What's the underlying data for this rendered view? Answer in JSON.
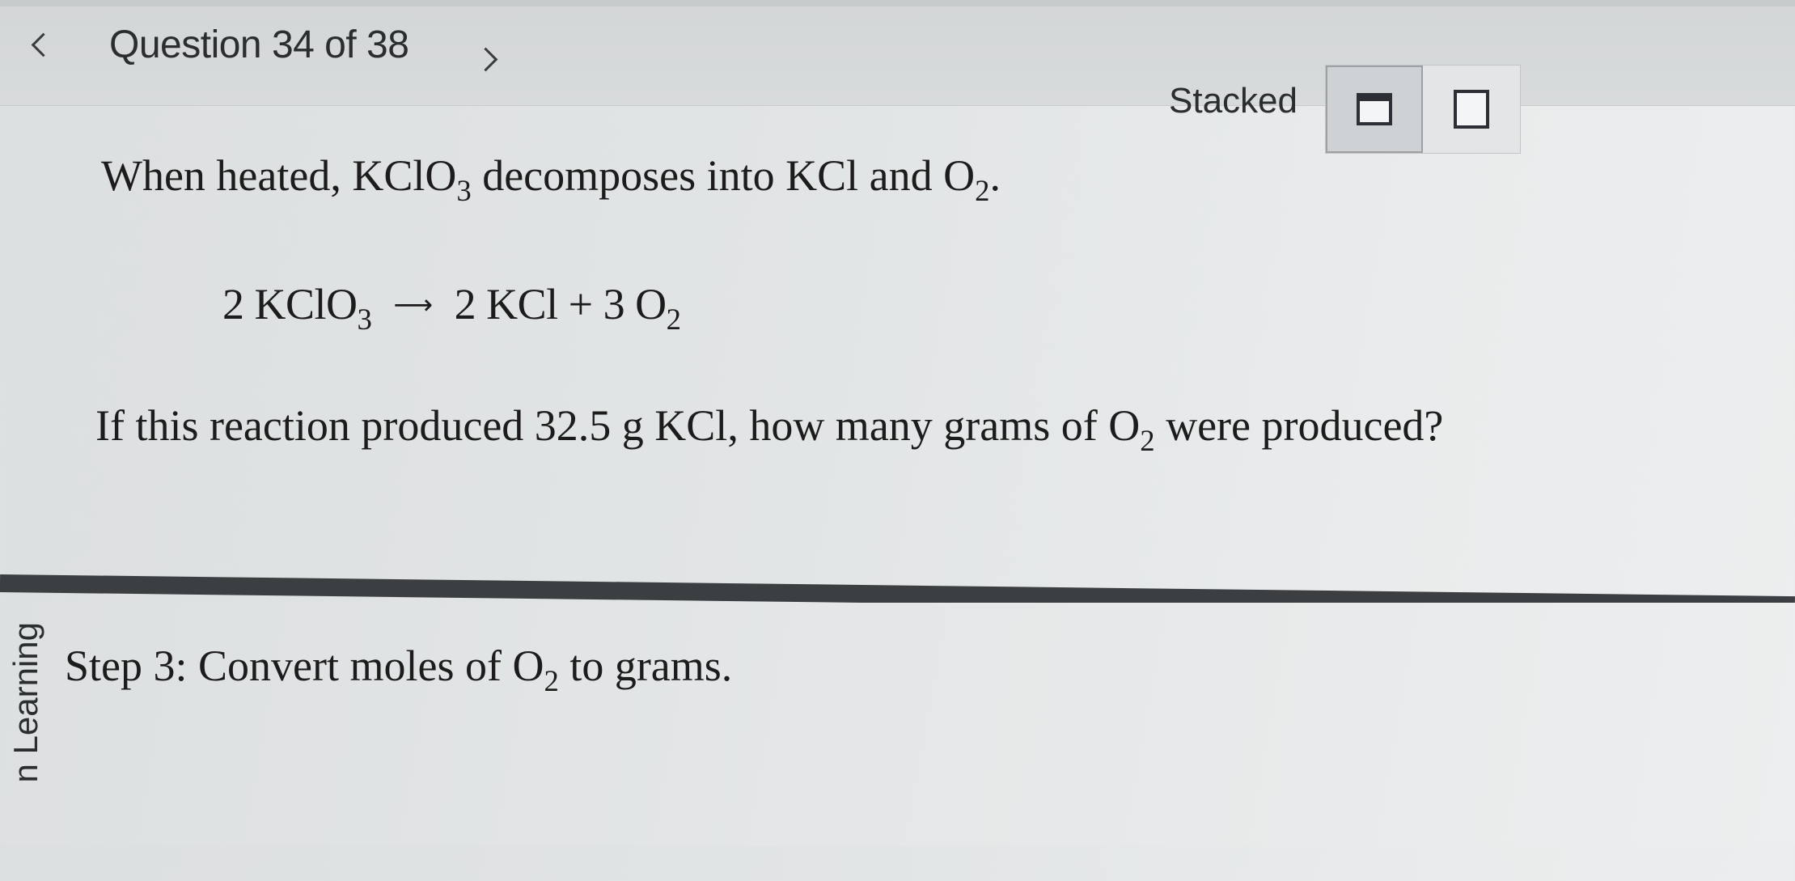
{
  "nav": {
    "title": "Question 34 of 38",
    "view_label": "Stacked"
  },
  "problem": {
    "intro_text": "When heated,",
    "intro_reactant": "KClO",
    "intro_reactant_sub": "3",
    "intro_mid": "decomposes into KCl and O",
    "intro_product_sub": "2",
    "intro_end": ".",
    "equation": {
      "coef1": "2",
      "reactant": "KClO",
      "reactant_sub": "3",
      "coef2": "2",
      "product1": "KCl",
      "plus": "+",
      "coef3": "3",
      "product2": "O",
      "product2_sub": "2"
    },
    "question_start": "If this reaction produced 32.5 g KCl, how many grams of O",
    "question_sub": "2",
    "question_end": "were produced?"
  },
  "step": {
    "text_start": "Step 3: Convert moles of O",
    "text_sub": "2",
    "text_end": "to grams."
  },
  "side_label": "n Learning"
}
